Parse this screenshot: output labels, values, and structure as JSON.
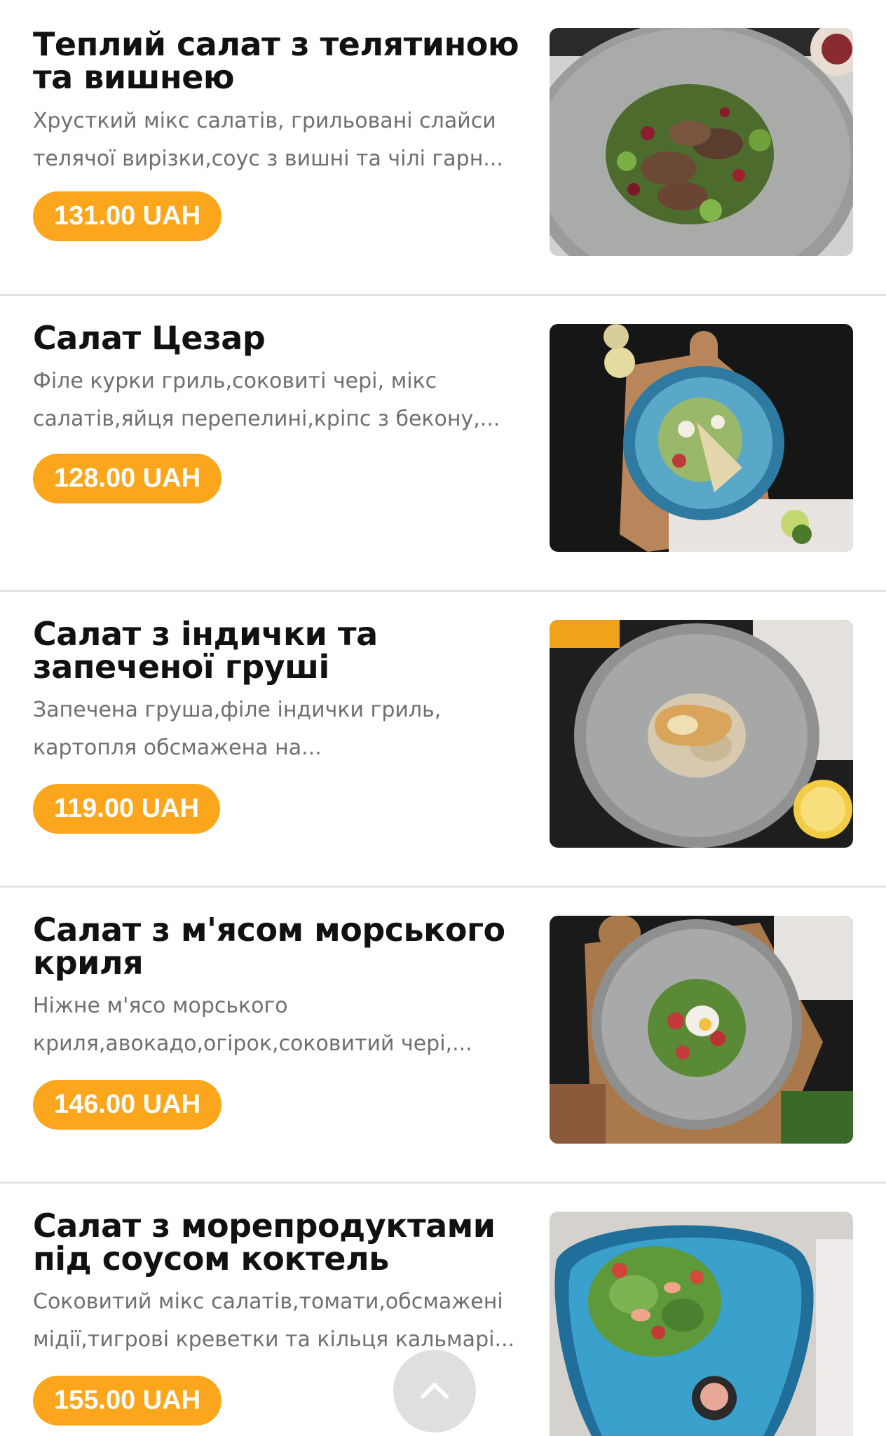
{
  "items": [
    {
      "title": "Теплий салат з телятиною та вишнею",
      "description": "Хрусткий мікс салатів, грильовані слайси телячої вирізки,соус з вишні та чілі гарн...",
      "price": "131.00 UAH",
      "photo": "veal-cherry-salad-photo"
    },
    {
      "title": "Салат Цезар",
      "description": "Філе курки гриль,соковиті чері, мікс салатів,яйця перепелині,кріпс з бекону,...",
      "price": "128.00 UAH",
      "photo": "caesar-salad-photo"
    },
    {
      "title": "Салат з індички та запеченої груші",
      "description": "Запечена груша,філе індички гриль, картопля обсмажена на...",
      "price": "119.00 UAH",
      "photo": "turkey-pear-salad-photo"
    },
    {
      "title": "Салат з м'ясом морського криля",
      "description": "Ніжне м'ясо морського криля,авокадо,огірок,соковитий чері,...",
      "price": "146.00 UAH",
      "photo": "krill-salad-photo"
    },
    {
      "title": "Салат з морепродуктами під соусом коктель",
      "description": "Соковитий мікс салатів,томати,обсмажені мідії,тигрові креветки та кільця кальмарі...",
      "price": "155.00 UAH",
      "photo": "seafood-salad-photo"
    }
  ],
  "scroll_top_icon": "chevron-up-icon",
  "colors": {
    "price_badge": "#fba61c",
    "title": "#111111",
    "description": "#6f6f6f",
    "divider": "#e3e3e3"
  }
}
